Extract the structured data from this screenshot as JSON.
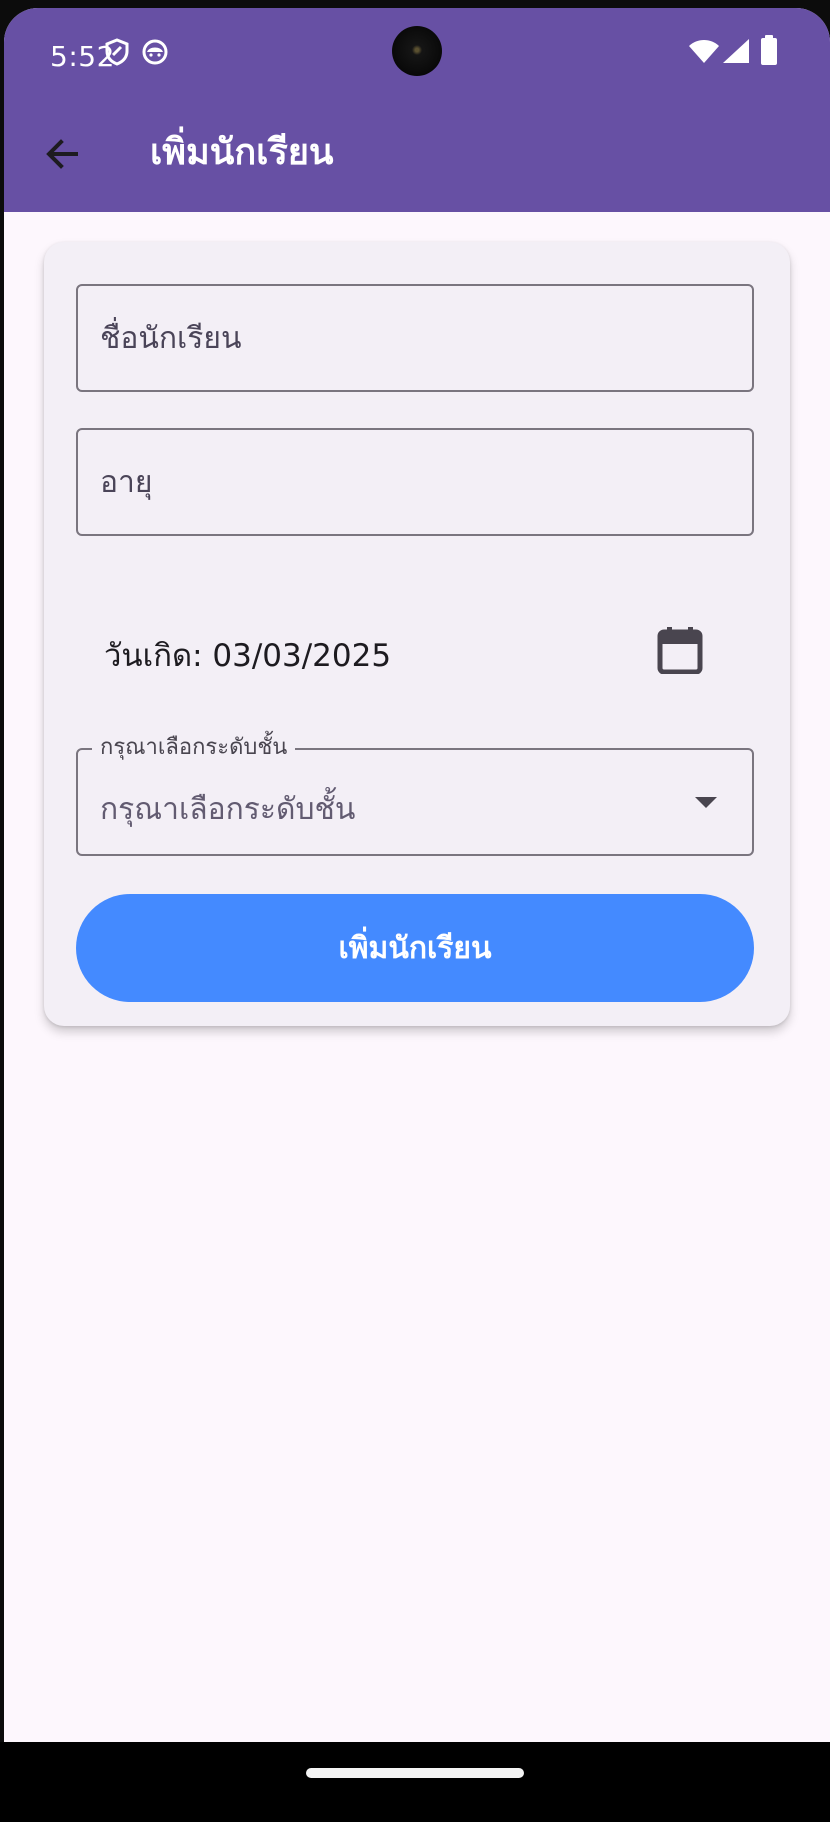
{
  "status_bar": {
    "time": "5:52",
    "icons_left": [
      "shield-icon",
      "cat-face-icon"
    ],
    "icons_right": [
      "wifi-icon",
      "signal-icon",
      "battery-icon"
    ]
  },
  "app_bar": {
    "title": "เพิ่มนักเรียน",
    "back_icon": "arrow-back-icon"
  },
  "form": {
    "student_name": {
      "value": "",
      "placeholder": "ชื่อนักเรียน"
    },
    "age": {
      "value": "",
      "placeholder": "อายุ"
    },
    "birth_date": {
      "label": "วันเกิด: 03/03/2025",
      "icon": "calendar-icon"
    },
    "grade_level": {
      "label": "กรุณาเลือกระดับชั้น",
      "selected": "กรุณาเลือกระดับชั้น",
      "icon": "dropdown-arrow-icon"
    },
    "submit_label": "เพิ่มนักเรียน"
  },
  "colors": {
    "primary": "#6750a4",
    "button": "#448aff",
    "background": "#fdf7fd",
    "card": "#f3eff6",
    "outline": "#7a757f"
  }
}
